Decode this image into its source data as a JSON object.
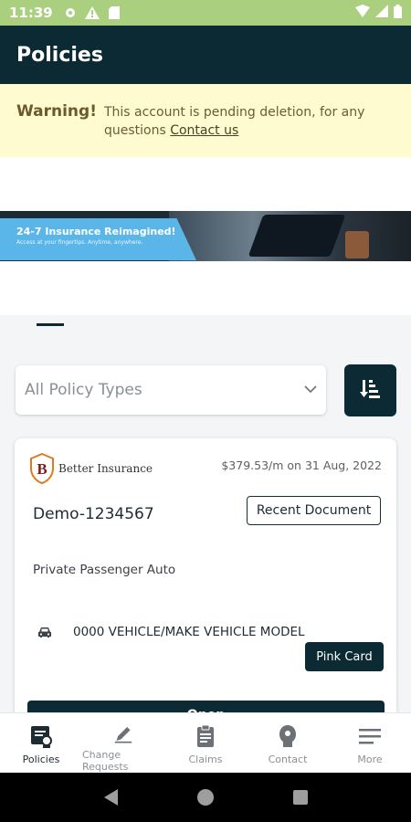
{
  "status_bar": {
    "time": "11:39",
    "icons": [
      "gear-icon",
      "alert-icon",
      "sim-icon",
      "wifi-icon",
      "signal-icon",
      "battery-icon"
    ]
  },
  "app_bar": {
    "title": "Policies"
  },
  "warning": {
    "label": "Warning!",
    "message": "This account is pending deletion, for any questions",
    "link": "Contact us"
  },
  "banner": {
    "headline": "24-7 Insurance Reimagined!",
    "subline": "Access at your fingertips. Anytime, anywhere."
  },
  "filter": {
    "selected": "All Policy Types",
    "sort_icon": "sort-icon"
  },
  "policy_card": {
    "company": "Better Insurance",
    "premium": "$379.53/m on 31 Aug, 2022",
    "policy_number": "Demo-1234567",
    "recent_document_label": "Recent Document",
    "policy_type": "Private Passenger Auto",
    "vehicle": "0000 VEHICLE/MAKE VEHICLE MODEL",
    "pink_card_label": "Pink Card",
    "open_label": "Open"
  },
  "bottom_nav": {
    "items": [
      {
        "label": "Policies",
        "icon": "policies-icon",
        "active": true
      },
      {
        "label": "Change Requests",
        "icon": "pen-icon",
        "active": false
      },
      {
        "label": "Claims",
        "icon": "clipboard-icon",
        "active": false
      },
      {
        "label": "Contact",
        "icon": "contact-icon",
        "active": false
      },
      {
        "label": "More",
        "icon": "menu-icon",
        "active": false
      }
    ]
  },
  "colors": {
    "primary": "#0b2a33",
    "status_bar": "#a9cf7f",
    "warning_bg": "#fffbd0",
    "banner_blue": "#5ab6e8",
    "logo_accent": "#e07a1f"
  }
}
